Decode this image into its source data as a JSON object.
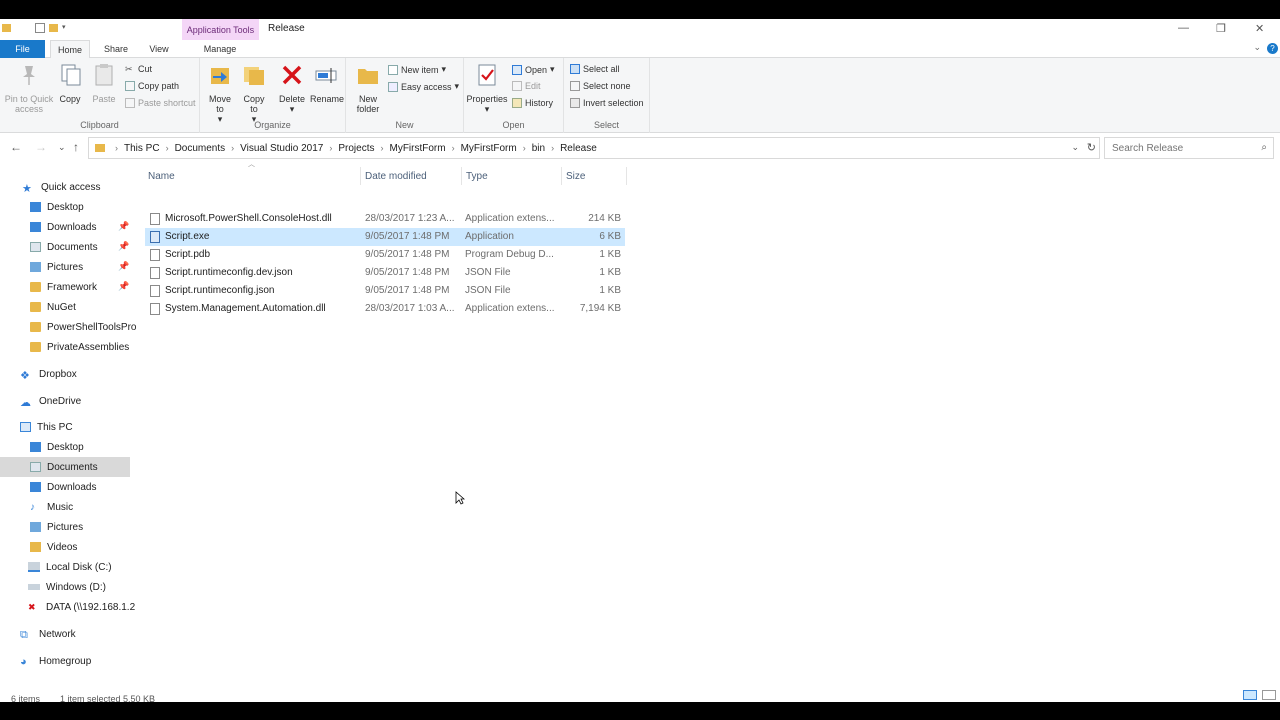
{
  "titlebar": {
    "context_tab": "Application Tools",
    "title": "Release"
  },
  "ribbon_tabs": [
    {
      "label": "File"
    },
    {
      "label": "Home"
    },
    {
      "label": "Share"
    },
    {
      "label": "View"
    },
    {
      "label": "Manage"
    }
  ],
  "ribbon": {
    "clipboard": {
      "label": "Clipboard",
      "pin": "Pin to Quick access",
      "copy": "Copy",
      "paste": "Paste",
      "cut": "Cut",
      "copy_path": "Copy path",
      "paste_shortcut": "Paste shortcut"
    },
    "organize": {
      "label": "Organize",
      "move_to": "Move to",
      "copy_to": "Copy to",
      "delete": "Delete",
      "rename": "Rename"
    },
    "new": {
      "label": "New",
      "new_folder": "New folder",
      "new_item": "New item",
      "easy_access": "Easy access"
    },
    "open": {
      "label": "Open",
      "properties": "Properties",
      "open": "Open",
      "edit": "Edit",
      "history": "History"
    },
    "select": {
      "label": "Select",
      "select_all": "Select all",
      "select_none": "Select none",
      "invert": "Invert selection"
    }
  },
  "address": {
    "crumbs": [
      "This PC",
      "Documents",
      "Visual Studio 2017",
      "Projects",
      "MyFirstForm",
      "MyFirstForm",
      "bin",
      "Release"
    ],
    "search_placeholder": "Search Release"
  },
  "navpane": {
    "quick_access": "Quick access",
    "quick_items": [
      "Desktop",
      "Downloads",
      "Documents",
      "Pictures",
      "Framework",
      "NuGet",
      "PowerShellToolsPro",
      "PrivateAssemblies"
    ],
    "dropbox": "Dropbox",
    "onedrive": "OneDrive",
    "this_pc": "This PC",
    "pc_items": [
      "Desktop",
      "Documents",
      "Downloads",
      "Music",
      "Pictures",
      "Videos",
      "Local Disk (C:)",
      "Windows (D:)",
      "DATA (\\\\192.168.1.2"
    ],
    "network": "Network",
    "homegroup": "Homegroup"
  },
  "columns": {
    "name": "Name",
    "date": "Date modified",
    "type": "Type",
    "size": "Size"
  },
  "files": [
    {
      "name": "Microsoft.PowerShell.ConsoleHost.dll",
      "date": "28/03/2017 1:23 A...",
      "type": "Application extens...",
      "size": "214 KB"
    },
    {
      "name": "Script.exe",
      "date": "9/05/2017 1:48 PM",
      "type": "Application",
      "size": "6 KB"
    },
    {
      "name": "Script.pdb",
      "date": "9/05/2017 1:48 PM",
      "type": "Program Debug D...",
      "size": "1 KB"
    },
    {
      "name": "Script.runtimeconfig.dev.json",
      "date": "9/05/2017 1:48 PM",
      "type": "JSON File",
      "size": "1 KB"
    },
    {
      "name": "Script.runtimeconfig.json",
      "date": "9/05/2017 1:48 PM",
      "type": "JSON File",
      "size": "1 KB"
    },
    {
      "name": "System.Management.Automation.dll",
      "date": "28/03/2017 1:03 A...",
      "type": "Application extens...",
      "size": "7,194 KB"
    }
  ],
  "status": {
    "items": "6 items",
    "selected": "1 item selected  5.50 KB"
  },
  "colors": {
    "file_tab": "#1979ca",
    "context_tab": "#f4d6f7",
    "selection": "#cce8ff",
    "nav_selected": "#d9d9d9"
  }
}
